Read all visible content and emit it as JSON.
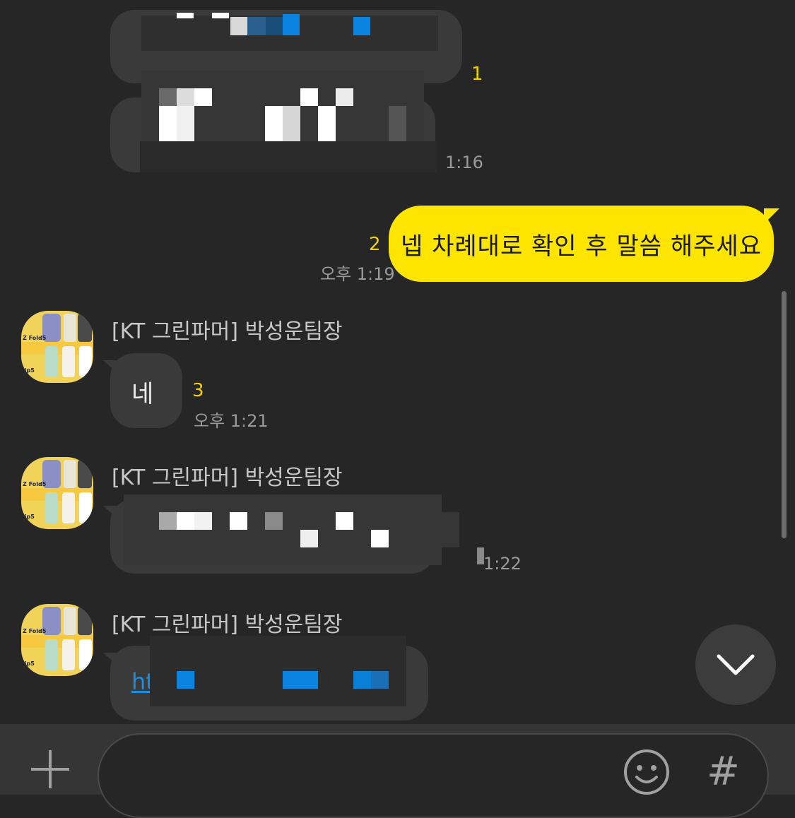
{
  "messages": {
    "m1": {
      "unread": "1",
      "time": "1:16"
    },
    "m2": {
      "text": "넵 차례대로 확인 후 말씀 해주세요",
      "unread": "2",
      "time": "오후 1:19"
    },
    "m3": {
      "sender": "[KT 그린파머] 박성운팀장",
      "text": "네",
      "unread": "3",
      "time": "오후 1:21"
    },
    "m4": {
      "sender": "[KT 그린파머] 박성운팀장",
      "time": "1:22"
    },
    "m5": {
      "sender": "[KT 그린파머] 박성운팀장",
      "link_prefix": "ht"
    }
  },
  "avatar": {
    "label_top": "Z Fold5",
    "label_bottom": "lip5"
  },
  "input": {
    "placeholder": ""
  },
  "icons": {
    "scroll_down": "chevron-down-icon",
    "plus": "plus-icon",
    "emoji": "emoji-icon",
    "hash": "#"
  },
  "colors": {
    "my_bubble": "#fee500",
    "other_bubble": "#3a3a3a",
    "unread": "#f2d100",
    "background": "#262626"
  }
}
